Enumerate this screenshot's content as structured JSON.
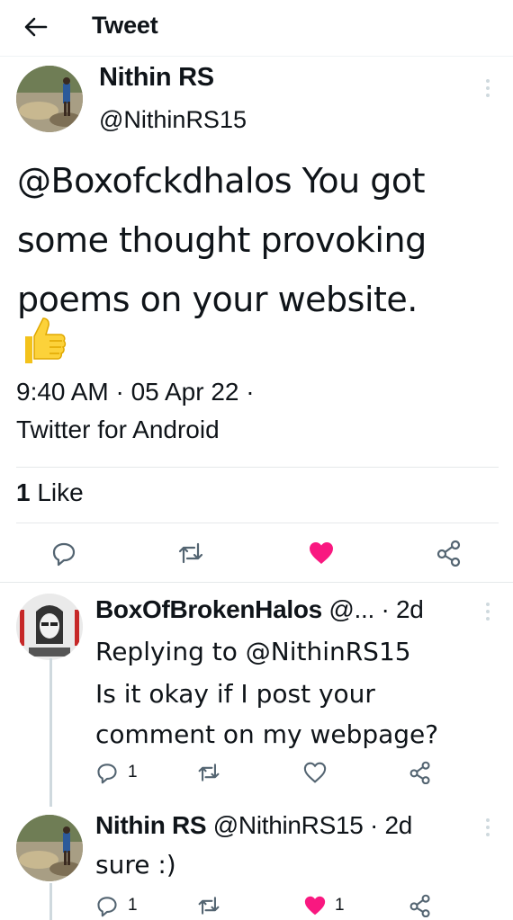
{
  "header": {
    "title": "Tweet",
    "back_icon": "arrow-left-icon"
  },
  "tweet": {
    "author_name": "Nithin RS",
    "author_handle": "@NithinRS15",
    "text_lines": [
      "@Boxofckdhalos You got",
      "some thought provoking",
      "poems on your website."
    ],
    "emoji": "thumbs-up-icon",
    "time_line": "9:40 AM · 05 Apr 22 ·",
    "source": "Twitter for Android",
    "likes_count": "1",
    "likes_label": " Like",
    "liked": true,
    "actions": [
      "reply-icon",
      "retweet-icon",
      "like-icon",
      "share-icon"
    ],
    "like_color": "#f91880"
  },
  "replies": [
    {
      "name": "BoxOfBrokenHalos",
      "handle_time": " @... · 2d",
      "replying_to": "Replying to @NithinRS15",
      "text_lines": [
        "Is it okay if I post your",
        "comment on my webpage?"
      ],
      "reply_count": "1",
      "like_count": "",
      "liked": false
    },
    {
      "name": "Nithin RS",
      "handle_time": " @NithinRS15 · 2d",
      "text_lines": [
        "sure :)"
      ],
      "reply_count": "1",
      "like_count": "1",
      "liked": true
    }
  ]
}
